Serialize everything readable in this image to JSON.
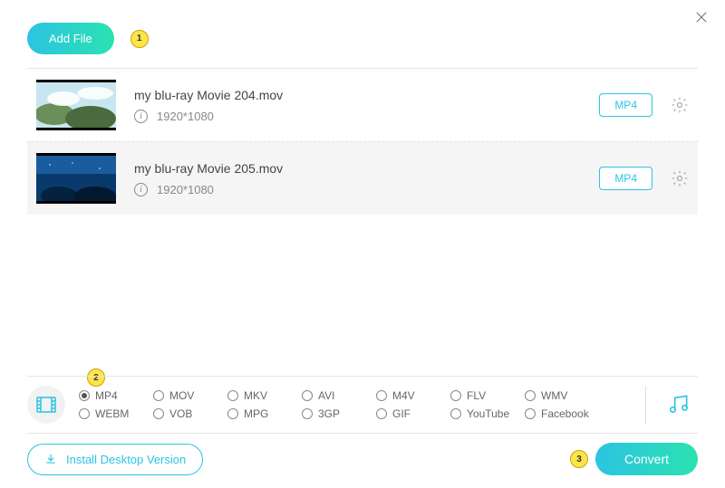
{
  "header": {
    "add_file_label": "Add File",
    "annotation_1": "1"
  },
  "files": [
    {
      "name": "my blu-ray Movie 204.mov",
      "resolution": "1920*1080",
      "format": "MP4",
      "selected": false,
      "thumb": "clouds"
    },
    {
      "name": "my blu-ray Movie 205.mov",
      "resolution": "1920*1080",
      "format": "MP4",
      "selected": true,
      "thumb": "underwater"
    }
  ],
  "formats": {
    "annotation_2": "2",
    "options": [
      {
        "label": "MP4",
        "checked": true
      },
      {
        "label": "MOV",
        "checked": false
      },
      {
        "label": "MKV",
        "checked": false
      },
      {
        "label": "AVI",
        "checked": false
      },
      {
        "label": "M4V",
        "checked": false
      },
      {
        "label": "FLV",
        "checked": false
      },
      {
        "label": "WMV",
        "checked": false
      },
      {
        "label": "WEBM",
        "checked": false
      },
      {
        "label": "VOB",
        "checked": false
      },
      {
        "label": "MPG",
        "checked": false
      },
      {
        "label": "3GP",
        "checked": false
      },
      {
        "label": "GIF",
        "checked": false
      },
      {
        "label": "YouTube",
        "checked": false
      },
      {
        "label": "Facebook",
        "checked": false
      }
    ]
  },
  "footer": {
    "install_label": "Install Desktop Version",
    "convert_label": "Convert",
    "annotation_3": "3"
  }
}
